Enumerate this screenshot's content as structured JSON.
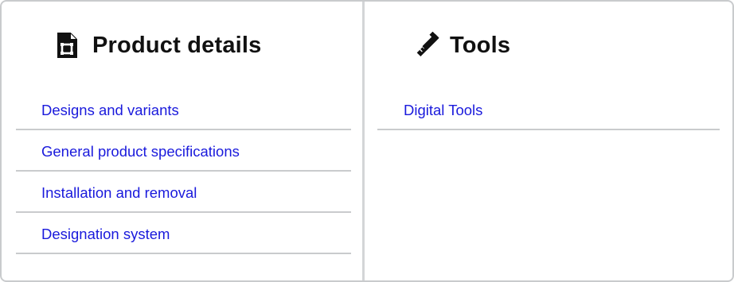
{
  "product_details": {
    "title": "Product details",
    "icon": "document-icon",
    "links": [
      {
        "label": "Designs and variants"
      },
      {
        "label": "General product specifications"
      },
      {
        "label": "Installation and removal"
      },
      {
        "label": "Designation system"
      }
    ]
  },
  "tools": {
    "title": "Tools",
    "icon": "hammer-ruler-icon",
    "links": [
      {
        "label": "Digital Tools"
      }
    ]
  },
  "colors": {
    "link": "#1a1adc",
    "border": "#c9cbcd",
    "title": "#111111"
  }
}
